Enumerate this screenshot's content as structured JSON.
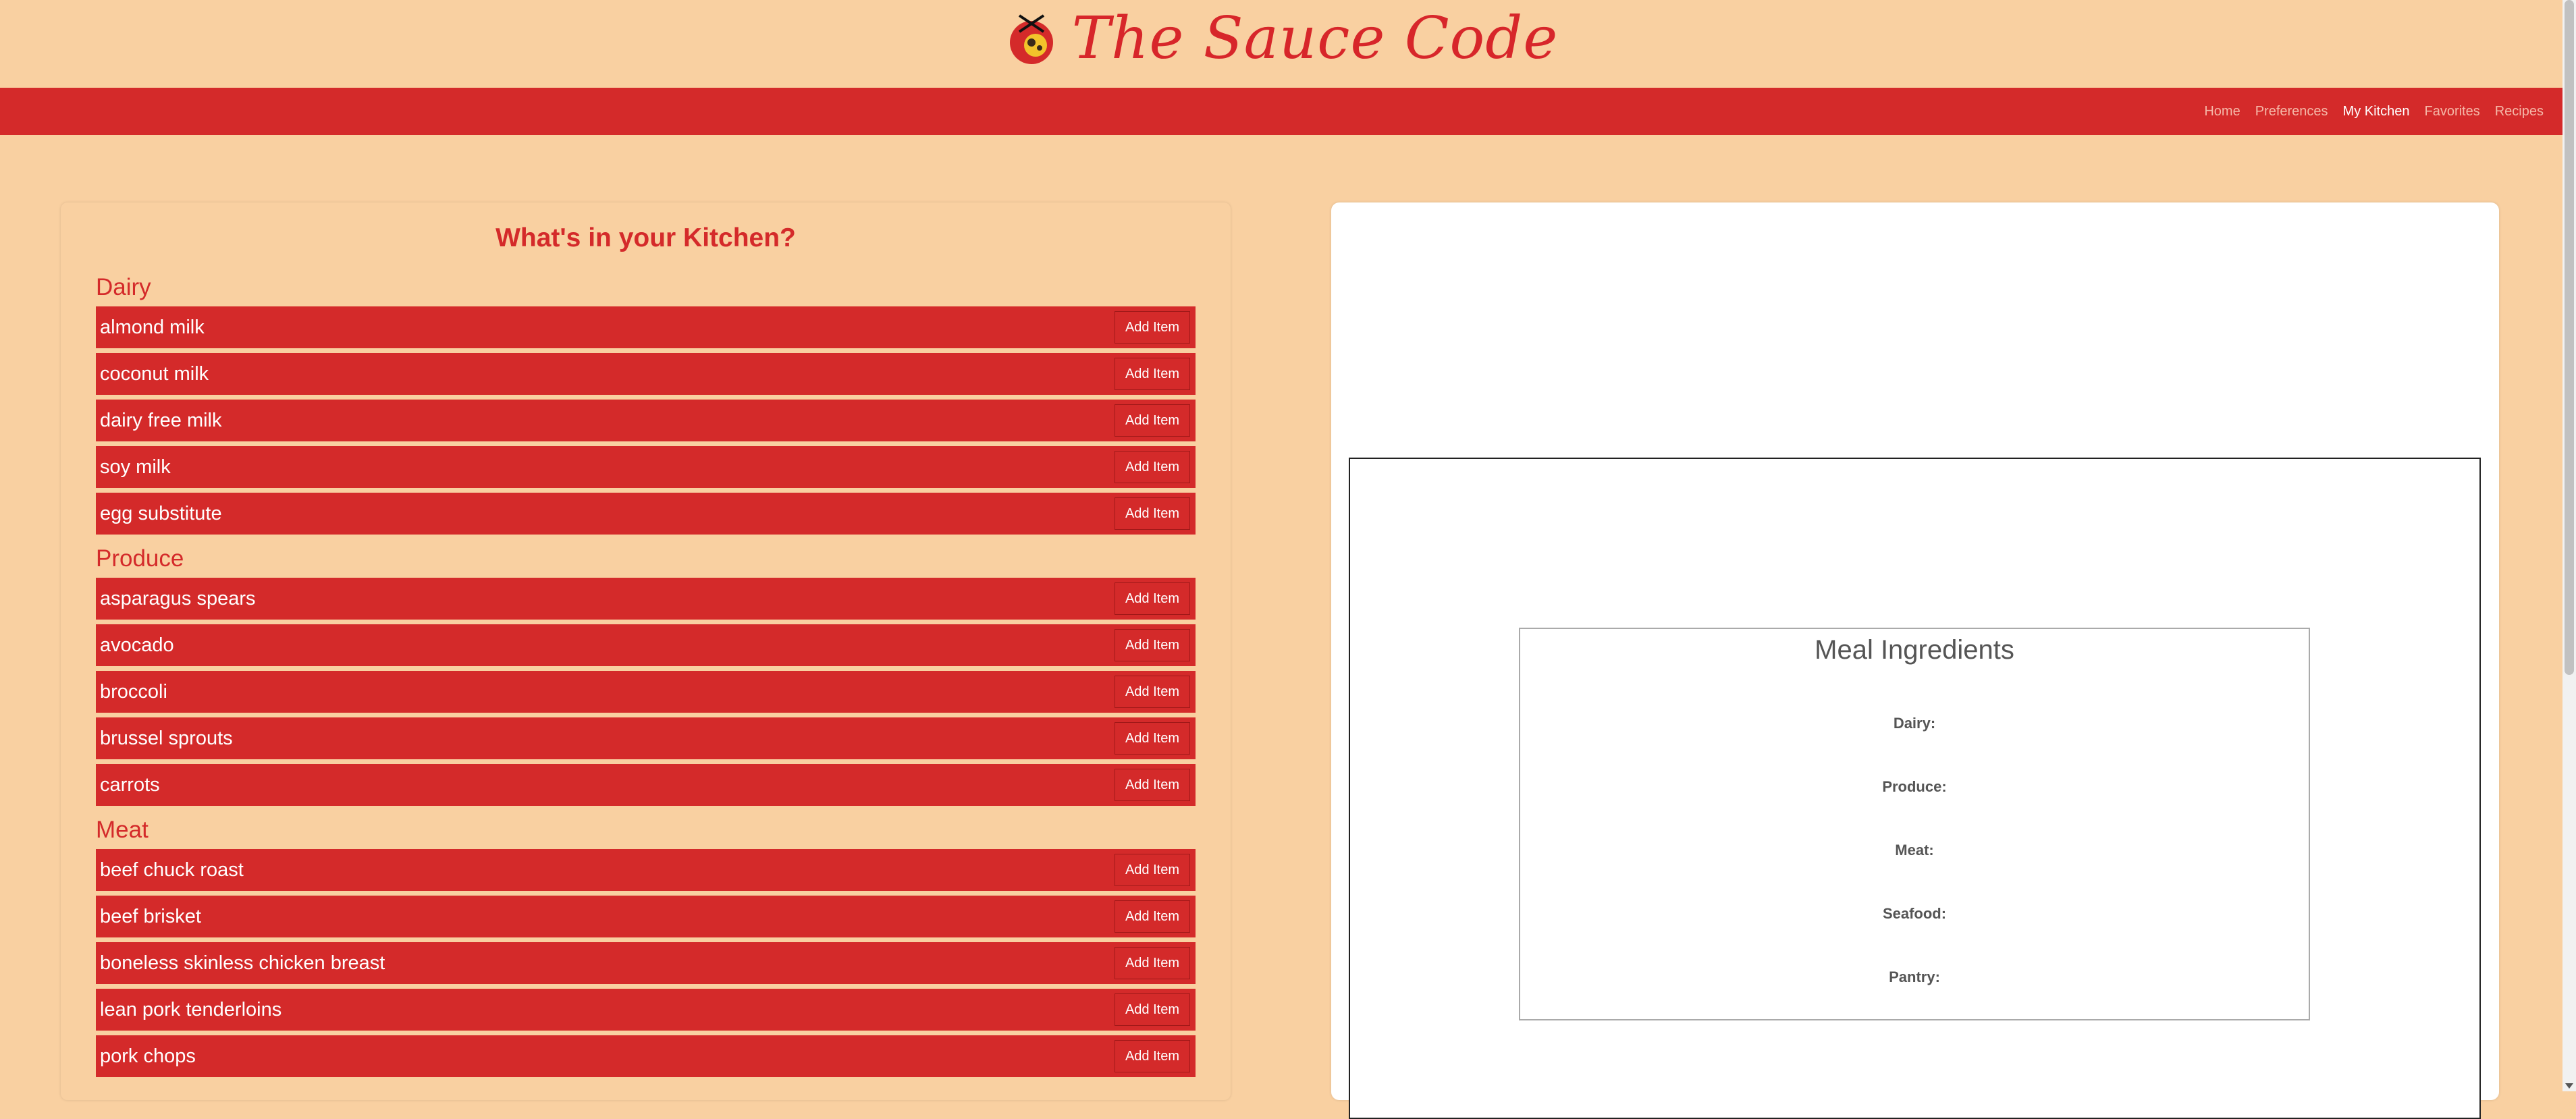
{
  "brand": {
    "name": "The Sauce Code",
    "logo_icon": "sauce-pot-logo"
  },
  "nav": {
    "items": [
      {
        "label": "Home"
      },
      {
        "label": "Preferences"
      },
      {
        "label": "My Kitchen"
      },
      {
        "label": "Favorites"
      },
      {
        "label": "Recipes"
      }
    ],
    "active": "My Kitchen"
  },
  "kitchen": {
    "title": "What's in your Kitchen?",
    "add_label": "Add Item",
    "categories": [
      {
        "name": "Dairy",
        "items": [
          "almond milk",
          "coconut milk",
          "dairy free milk",
          "soy milk",
          "egg substitute"
        ]
      },
      {
        "name": "Produce",
        "items": [
          "asparagus spears",
          "avocado",
          "broccoli",
          "brussel sprouts",
          "carrots"
        ]
      },
      {
        "name": "Meat",
        "items": [
          "beef chuck roast",
          "beef brisket",
          "boneless skinless chicken breast",
          "lean pork tenderloins",
          "pork chops"
        ]
      }
    ]
  },
  "meal": {
    "title": "Meal Ingredients",
    "labels": [
      "Dairy:",
      "Produce:",
      "Meat:",
      "Seafood:",
      "Pantry:"
    ]
  },
  "colors": {
    "background": "#f9d0a1",
    "accent": "#d42a2a"
  }
}
